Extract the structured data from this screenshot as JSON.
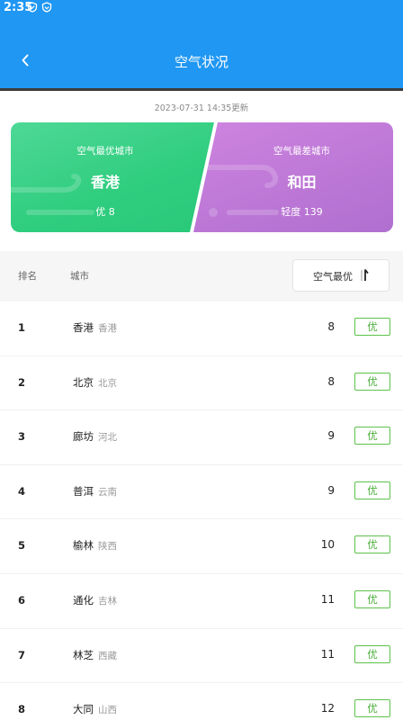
{
  "status_bar": {
    "time": "2:35",
    "icons": [
      "shield-icon",
      "shield-icon"
    ]
  },
  "header": {
    "title": "空气状况",
    "back_icon": "chevron-left-icon"
  },
  "update_time": "2023-07-31 14:35更新",
  "best_card": {
    "label": "空气最优城市",
    "city": "香港",
    "value": "优 8"
  },
  "worst_card": {
    "label": "空气最差城市",
    "city": "和田",
    "value": "轻度 139"
  },
  "list_header": {
    "rank": "排名",
    "city": "城市",
    "sort": "空气最优",
    "sort_icon": "sort-icon"
  },
  "rows": [
    {
      "rank": "1",
      "city": "香港",
      "province": "香港",
      "aqi": "8",
      "level": "优"
    },
    {
      "rank": "2",
      "city": "北京",
      "province": "北京",
      "aqi": "8",
      "level": "优"
    },
    {
      "rank": "3",
      "city": "廊坊",
      "province": "河北",
      "aqi": "9",
      "level": "优"
    },
    {
      "rank": "4",
      "city": "普洱",
      "province": "云南",
      "aqi": "9",
      "level": "优"
    },
    {
      "rank": "5",
      "city": "榆林",
      "province": "陕西",
      "aqi": "10",
      "level": "优"
    },
    {
      "rank": "6",
      "city": "通化",
      "province": "吉林",
      "aqi": "11",
      "level": "优"
    },
    {
      "rank": "7",
      "city": "林芝",
      "province": "西藏",
      "aqi": "11",
      "level": "优"
    },
    {
      "rank": "8",
      "city": "大同",
      "province": "山西",
      "aqi": "12",
      "level": "优"
    }
  ],
  "colors": {
    "header": "#1f97f3",
    "best": "#2fcd7e",
    "worst": "#c27bd9",
    "level_good": "#4caf3a"
  }
}
